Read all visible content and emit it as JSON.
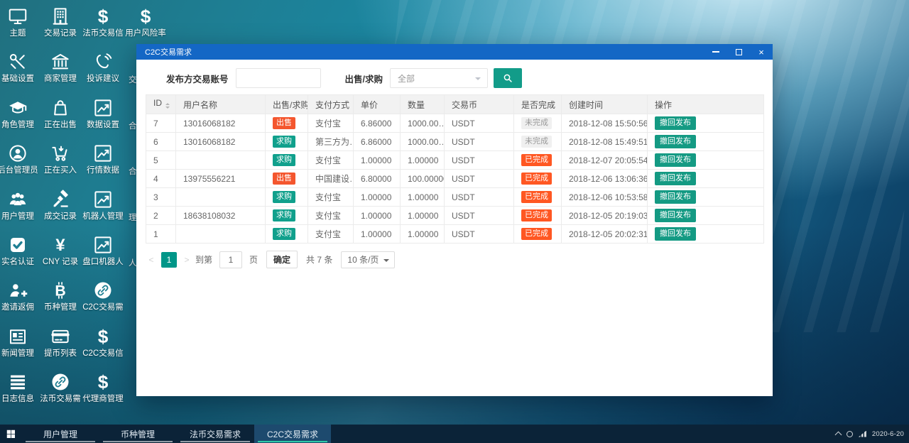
{
  "desktop": {
    "icons": [
      {
        "label": "主题",
        "icon": "monitor"
      },
      {
        "label": "基础设置",
        "icon": "wrench"
      },
      {
        "label": "角色管理",
        "icon": "grad-cap"
      },
      {
        "label": "后台管理员",
        "icon": "admin-person"
      },
      {
        "label": "用户管理",
        "icon": "users"
      },
      {
        "label": "实名认证",
        "icon": "check-square"
      },
      {
        "label": "邀请返佣",
        "icon": "person-plus"
      },
      {
        "label": "新闻管理",
        "icon": "newspaper"
      },
      {
        "label": "日志信息",
        "icon": "list"
      },
      {
        "label": "交易记录",
        "icon": "building"
      },
      {
        "label": "商家管理",
        "icon": "bank"
      },
      {
        "label": "正在出售",
        "icon": "bag"
      },
      {
        "label": "正在买入",
        "icon": "cart"
      },
      {
        "label": "成交记录",
        "icon": "gavel"
      },
      {
        "label": "CNY 记录",
        "icon": "yen"
      },
      {
        "label": "币种管理",
        "icon": "bitcoin"
      },
      {
        "label": "提币列表",
        "icon": "card"
      },
      {
        "label": "法币交易需",
        "icon": "link-circle"
      },
      {
        "label": "法币交易信",
        "icon": "dollar"
      },
      {
        "label": "投诉建议",
        "icon": "phone"
      },
      {
        "label": "数据设置",
        "icon": "chart"
      },
      {
        "label": "行情数据",
        "icon": "chart"
      },
      {
        "label": "机器人管理",
        "icon": "chart"
      },
      {
        "label": "盘口机器人",
        "icon": "chart"
      },
      {
        "label": "C2C交易需",
        "icon": "link-circle"
      },
      {
        "label": "C2C交易信",
        "icon": "dollar"
      },
      {
        "label": "代理商管理",
        "icon": "dollar"
      },
      {
        "label": "用户风险率",
        "icon": "dollar"
      }
    ],
    "partial_labels": [
      {
        "text": "交",
        "row": 1
      },
      {
        "text": "合",
        "row": 2
      },
      {
        "text": "合",
        "row": 3
      },
      {
        "text": "理",
        "row": 4
      },
      {
        "text": "人",
        "row": 5
      }
    ]
  },
  "window": {
    "title": "C2C交易需求",
    "toolbar": {
      "account_label": "发布方交易账号",
      "account_value": "",
      "type_label": "出售/求购",
      "type_value": "全部"
    },
    "table": {
      "columns": [
        "ID",
        "用户名称",
        "出售/求购",
        "支付方式",
        "单价",
        "数量",
        "交易币",
        "是否完成",
        "创建时间",
        "操作"
      ],
      "rows": [
        {
          "id": "7",
          "user": "13016068182",
          "type": "出售",
          "type_style": "sell",
          "pay": "支付宝",
          "price": "6.86000",
          "qty": "1000.00…",
          "coin": "USDT",
          "status": "未完成",
          "status_style": "pending",
          "time": "2018-12-08 15:50:56",
          "action": "撤回发布"
        },
        {
          "id": "6",
          "user": "13016068182",
          "type": "求购",
          "type_style": "buy",
          "pay": "第三方为…",
          "price": "6.86000",
          "qty": "1000.00…",
          "coin": "USDT",
          "status": "未完成",
          "status_style": "pending",
          "time": "2018-12-08 15:49:51",
          "action": "撤回发布"
        },
        {
          "id": "5",
          "user": "",
          "type": "求购",
          "type_style": "buy",
          "pay": "支付宝",
          "price": "1.00000",
          "qty": "1.00000",
          "coin": "USDT",
          "status": "已完成",
          "status_style": "done",
          "time": "2018-12-07 20:05:54",
          "action": "撤回发布"
        },
        {
          "id": "4",
          "user": "13975556221",
          "type": "出售",
          "type_style": "sell",
          "pay": "中国建设…",
          "price": "6.80000",
          "qty": "100.00000",
          "coin": "USDT",
          "status": "已完成",
          "status_style": "done",
          "time": "2018-12-06 13:06:36",
          "action": "撤回发布"
        },
        {
          "id": "3",
          "user": "",
          "type": "求购",
          "type_style": "buy",
          "pay": "支付宝",
          "price": "1.00000",
          "qty": "1.00000",
          "coin": "USDT",
          "status": "已完成",
          "status_style": "done",
          "time": "2018-12-06 10:53:58",
          "action": "撤回发布"
        },
        {
          "id": "2",
          "user": "18638108032",
          "type": "求购",
          "type_style": "buy",
          "pay": "支付宝",
          "price": "1.00000",
          "qty": "1.00000",
          "coin": "USDT",
          "status": "已完成",
          "status_style": "done",
          "time": "2018-12-05 20:19:03",
          "action": "撤回发布"
        },
        {
          "id": "1",
          "user": "",
          "type": "求购",
          "type_style": "buy",
          "pay": "支付宝",
          "price": "1.00000",
          "qty": "1.00000",
          "coin": "USDT",
          "status": "已完成",
          "status_style": "done",
          "time": "2018-12-05 20:02:31",
          "action": "撤回发布"
        }
      ]
    },
    "pagination": {
      "prev": "<",
      "page": "1",
      "next": ">",
      "goto_label": "到第",
      "goto_value": "1",
      "page_unit": "页",
      "confirm": "确定",
      "total": "共 7 条",
      "per_page": "10 条/页"
    }
  },
  "taskbar": {
    "items": [
      {
        "label": "用户管理",
        "active": false
      },
      {
        "label": "币种管理",
        "active": false
      },
      {
        "label": "法币交易需求",
        "active": false
      },
      {
        "label": "C2C交易需求",
        "active": true
      }
    ],
    "tray_clock": "2020-6-20"
  },
  "colors": {
    "titlebar_blue": "#1467c5",
    "accent_teal": "#009688",
    "sell_badge": "#f4562e",
    "buy_badge": "#10a08c",
    "done_badge": "#ff5722",
    "pending_badge_bg": "#f0f0f0",
    "taskbar_bg": "#0b2338"
  }
}
